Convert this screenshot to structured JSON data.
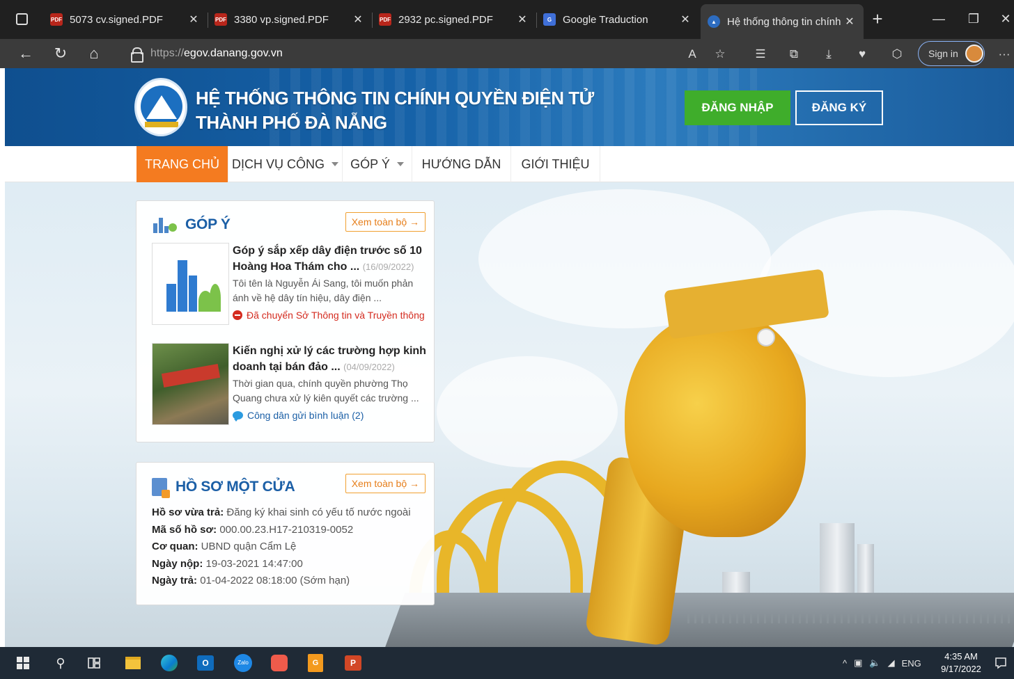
{
  "browser": {
    "tabs": [
      {
        "title": "5073 cv.signed.PDF",
        "favicon": "pdf-icon"
      },
      {
        "title": "3380 vp.signed.PDF",
        "favicon": "pdf-icon"
      },
      {
        "title": "2932 pc.signed.PDF",
        "favicon": "pdf-icon"
      },
      {
        "title": "Google Traduction",
        "favicon": "google-translate-icon"
      },
      {
        "title": "Hệ thống thông tin chính quyền điện tử",
        "favicon": "danang-icon"
      }
    ],
    "url_prefix": "https://",
    "url_host": "egov.danang.gov.vn",
    "signin_label": "Sign in"
  },
  "site": {
    "title_line1": "HỆ THỐNG THÔNG TIN CHÍNH QUYỀN ĐIỆN TỬ",
    "title_line2": "THÀNH PHỐ ĐÀ NẴNG",
    "login_label": "ĐĂNG NHẬP",
    "register_label": "ĐĂNG KÝ",
    "nav": [
      "TRANG CHỦ",
      "DỊCH VỤ CÔNG",
      "GÓP Ý",
      "HƯỚNG DẪN",
      "GIỚI THIỆU"
    ]
  },
  "gopy": {
    "title": "GÓP Ý",
    "view_all": "Xem toàn bộ →",
    "posts": [
      {
        "title": "Góp ý sắp xếp dây điện trước số 10 Hoàng Hoa Thám cho ...",
        "date": "(16/09/2022)",
        "excerpt": "Tôi tên là Nguyễn Ái Sang, tôi muốn phản ánh về hệ dây tín hiệu, dây điện ...",
        "status": "Đã chuyển Sở Thông tin và Truyền thông"
      },
      {
        "title": "Kiến nghị xử lý các trường hợp kinh doanh tại bán đảo ...",
        "date": "(04/09/2022)",
        "excerpt": "Thời gian qua, chính quyền phường Thọ Quang chưa xử lý kiên quyết các trường ...",
        "status": "Công dân gửi bình luận (2)"
      }
    ]
  },
  "hoso": {
    "title": "HỒ SƠ MỘT CỬA",
    "view_all": "Xem toàn bộ →",
    "rows": [
      {
        "label": "Hồ sơ vừa trả:",
        "value": "Đăng ký khai sinh có yếu tố nước ngoài"
      },
      {
        "label": "Mã số hồ sơ:",
        "value": "000.00.23.H17-210319-0052"
      },
      {
        "label": "Cơ quan:",
        "value": "UBND quận Cẩm Lệ"
      },
      {
        "label": "Ngày nộp:",
        "value": "19-03-2021 14:47:00"
      },
      {
        "label": "Ngày trả:",
        "value": "01-04-2022 08:18:00 (Sớm hạn)"
      }
    ]
  },
  "taskbar": {
    "lang": "ENG",
    "time": "4:35 AM",
    "date": "9/17/2022"
  }
}
